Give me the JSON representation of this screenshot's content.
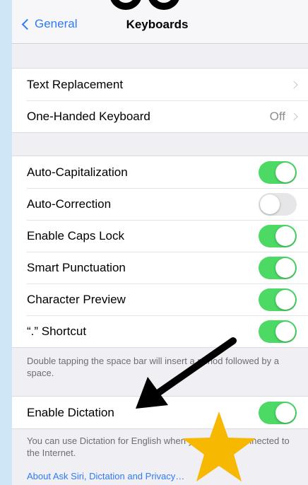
{
  "navbar": {
    "back_label": "General",
    "title": "Keyboards"
  },
  "group1": [
    {
      "label": "Text Replacement",
      "value": ""
    },
    {
      "label": "One-Handed Keyboard",
      "value": "Off"
    }
  ],
  "group2": [
    {
      "label": "Auto-Capitalization",
      "on": true
    },
    {
      "label": "Auto-Correction",
      "on": false
    },
    {
      "label": "Enable Caps Lock",
      "on": true
    },
    {
      "label": "Smart Punctuation",
      "on": true
    },
    {
      "label": "Character Preview",
      "on": true
    },
    {
      "label": "“.” Shortcut",
      "on": true
    }
  ],
  "shortcut_footer": "Double tapping the space bar will insert a period followed by a space.",
  "dictation": {
    "label": "Enable Dictation",
    "on": true,
    "footer": "You can use Dictation for English when you are not connected to the Internet.",
    "link": "About Ask Siri, Dictation and Privacy…"
  },
  "colors": {
    "accent": "#2d7cf6",
    "toggle_on": "#4cd964",
    "star": "#f6b800"
  }
}
